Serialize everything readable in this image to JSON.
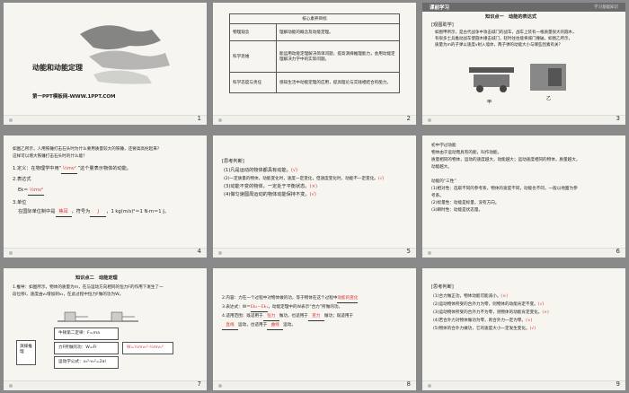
{
  "slides": [
    {
      "num": "1",
      "title": "动能和动能定理",
      "vertical": "机械能守恒定律",
      "vertical2": "第八章",
      "footer": "第一PPT模板网-WWW.1PPT.COM"
    },
    {
      "num": "2",
      "table_header": "核心素养目标",
      "rows": [
        {
          "k": "物理观念",
          "v": "理解动能的概念及动能定理。"
        },
        {
          "k": "科学思维",
          "v": "能运用动能定理解决简单问题，提高演绎推理能力，会用动能定理解决力学中的实际问题。"
        },
        {
          "k": "科学态度与责任",
          "v": "感知生活中动能定理的应用，提高理论与实践相结合的能力。"
        }
      ]
    },
    {
      "num": "3",
      "header": "课前学习",
      "header_right": "学习基础知识",
      "kp": "知识点一　动能的表达式",
      "label": "[观图助学]",
      "lines": [
        "如图甲所示，是古代战争中攻击城门的战车，战车上装有一根质量很大的圆木，",
        "有很多士兵推动战车使圆木撞击城门，轻时往往能将城门撞破。如图乙所示，",
        "质量为m的子弹以速度v射入墙体，两子弹的动能大小与哪些因素有关？"
      ],
      "cap1": "甲",
      "cap2": "乙"
    },
    {
      "num": "4",
      "lines": [
        "如图乙所示，人用铁锤打击石头时为什么要用质量较大的铁锤，还要高高抡起来?",
        "这样可以增大铁锤打击石头时的什么能？"
      ],
      "def1": "1.定义：在物理学中用“",
      "def1b": "”这个量表示物体的动能。",
      "formula_label": "2.表达式",
      "ek": "Ek＝",
      "ek_val": "½mv²",
      "unit_label": "3.单位",
      "unit_line_a": "在国际单位制中是",
      "unit_val": "焦耳",
      "unit_line_b": "，符号为",
      "unit_sym": "J",
      "unit_line_c": "，1 kg(m/s)²＝1 N·m＝1 J。"
    },
    {
      "num": "5",
      "label": "[思考判断]",
      "items": [
        {
          "t": "(1)凡是运动的物体都具有动能。",
          "a": "√"
        },
        {
          "t": "(2)一定质量的物体，动能变化时，速度一定变化，但速度变化时，动能不一定变化。",
          "a": "√"
        },
        {
          "t": "(3)动能不变的物体，一定处于平衡状态。",
          "a": "×"
        },
        {
          "t": "(4)做匀速圆周运动的物体动能保持不变。",
          "a": "√"
        }
      ]
    },
    {
      "num": "6",
      "lines": [
        "初中学过动能",
        "物体由于运动而具有的能，叫作动能。",
        "质量相同的物体，运动的速度越大，动能越大；运动速度相同的物体，质量越大，",
        "动能越大。",
        "",
        "动能的“三性”",
        "(1)相对性：选取不同的参考系，物体的速度不同，动能也不同，一般以地面为参",
        "考系。",
        "(2)标量性：动能是标量，没有方向。",
        "(3)瞬时性：动能是状态量。"
      ]
    },
    {
      "num": "7",
      "kp": "知识点二　动能定理",
      "lines": [
        "1.推导：如图所示，物体的质量为m，在与运动方向相同的恒力F的作用下发生了一",
        "段位移l，速度由v₁增加到v₂，在此过程中恒力F做的功为W。"
      ],
      "rule_label": "牛顿第二定律：F=ma",
      "force_label": "力F所做的功：W=Fl",
      "kin_label": "运动学公式：v₂²-v₁²=2al",
      "derive": "演绎推理",
      "w_label": "W=½mv₂²-½mv₁²"
    },
    {
      "num": "8",
      "lines": [
        "2.内容：力在一个过程中对物体做的功，等于物体在这个过程中",
        "3.表达式：W＝",
        "，动能定理中的W表示“合力”所做的功。",
        "4.适用范围：既适用于",
        "做功，也适用于",
        "做功；既适用于",
        "直线",
        "运动，也适用于",
        "运动。"
      ],
      "b1": "动能的变化",
      "b2": "Ek₂－Ek₁",
      "b3": "恒力",
      "b4": "变力",
      "b5": "直线",
      "b6": "曲线"
    },
    {
      "num": "9",
      "label": "[思考判断]",
      "items": [
        {
          "t": "(1)合力做正功，物体动能可能减小。",
          "a": "×"
        },
        {
          "t": "(2)运动物体所受的合外力为零，则物体的动能肯定不变。",
          "a": "√"
        },
        {
          "t": "(3)运动物体所受的合外力不为零，则物体的动能肯定变化。",
          "a": "×"
        },
        {
          "t": "(4)若合外力对物体做功为零，则合外力一定为零。",
          "a": "×"
        },
        {
          "t": "(5)物体的合外力做功，它的速度大小一定发生变化。",
          "a": "√"
        }
      ]
    }
  ]
}
